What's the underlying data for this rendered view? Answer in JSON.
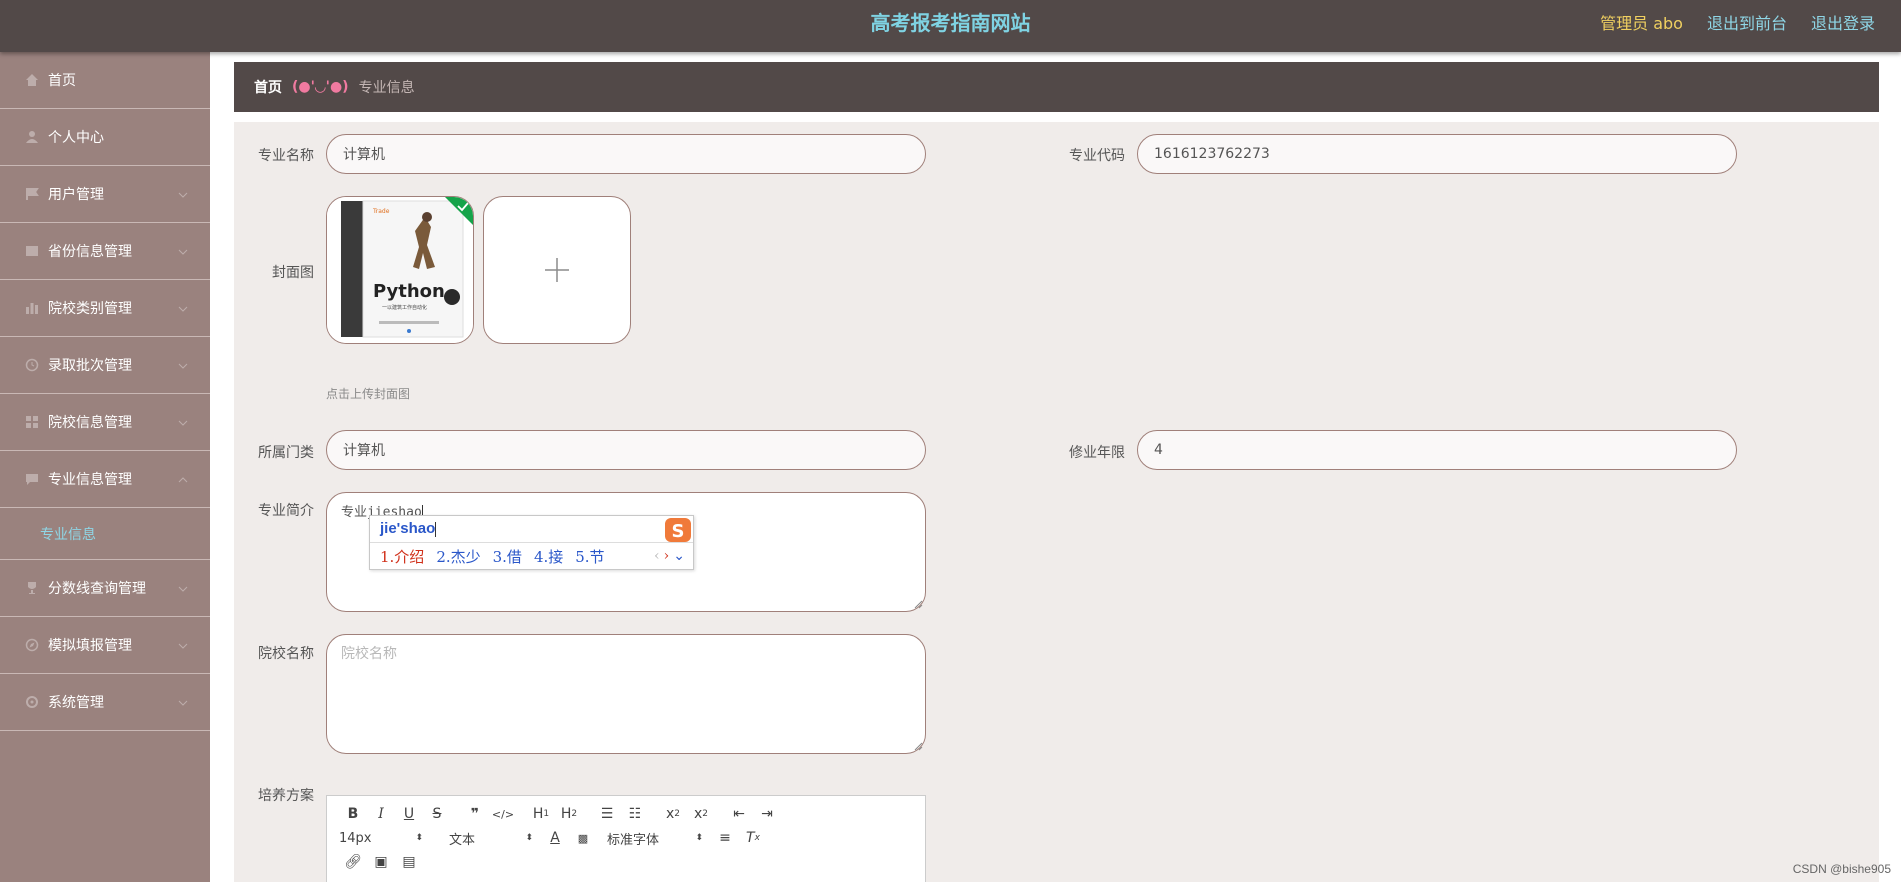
{
  "header": {
    "site_title": "高考报考指南网站",
    "admin_label": "管理员 abo",
    "back_to_front": "退出到前台",
    "logout": "退出登录"
  },
  "sidebar": {
    "items": [
      {
        "label": "首页",
        "icon": "home-icon"
      },
      {
        "label": "个人中心",
        "icon": "user-icon"
      },
      {
        "label": "用户管理",
        "icon": "flag-icon"
      },
      {
        "label": "省份信息管理",
        "icon": "list-icon"
      },
      {
        "label": "院校类别管理",
        "icon": "chart-icon"
      },
      {
        "label": "录取批次管理",
        "icon": "clock-icon"
      },
      {
        "label": "院校信息管理",
        "icon": "grid-icon"
      },
      {
        "label": "专业信息管理",
        "icon": "message-icon"
      },
      {
        "label": "专业信息",
        "icon": ""
      },
      {
        "label": "分数线查询管理",
        "icon": "trophy-icon"
      },
      {
        "label": "模拟填报管理",
        "icon": "compass-icon"
      },
      {
        "label": "系统管理",
        "icon": "settings-icon"
      }
    ]
  },
  "breadcrumb": {
    "home": "首页",
    "separator": "(●'◡'●)",
    "current": "专业信息"
  },
  "form": {
    "major_name_label": "专业名称",
    "major_name_value": "计算机",
    "major_code_label": "专业代码",
    "major_code_value": "1616123762273",
    "cover_label": "封面图",
    "cover_hint": "点击上传封面图",
    "category_label": "所属门类",
    "category_value": "计算机",
    "years_label": "修业年限",
    "years_value": "4",
    "intro_label": "专业简介",
    "intro_value": "专业jieshao",
    "school_label": "院校名称",
    "school_placeholder": "院校名称",
    "plan_label": "培养方案"
  },
  "cover_image": {
    "book_brand": "Python",
    "book_subtitle": "一以建筑工作自动化"
  },
  "ime": {
    "composition": "jie'shao",
    "candidates": [
      "1.介绍",
      "2.杰少",
      "3.借",
      "4.接",
      "5.节"
    ]
  },
  "editor": {
    "font_size": "14px",
    "block_type": "文本",
    "font_family": "标准字体"
  },
  "watermark": "CSDN @bishe905"
}
